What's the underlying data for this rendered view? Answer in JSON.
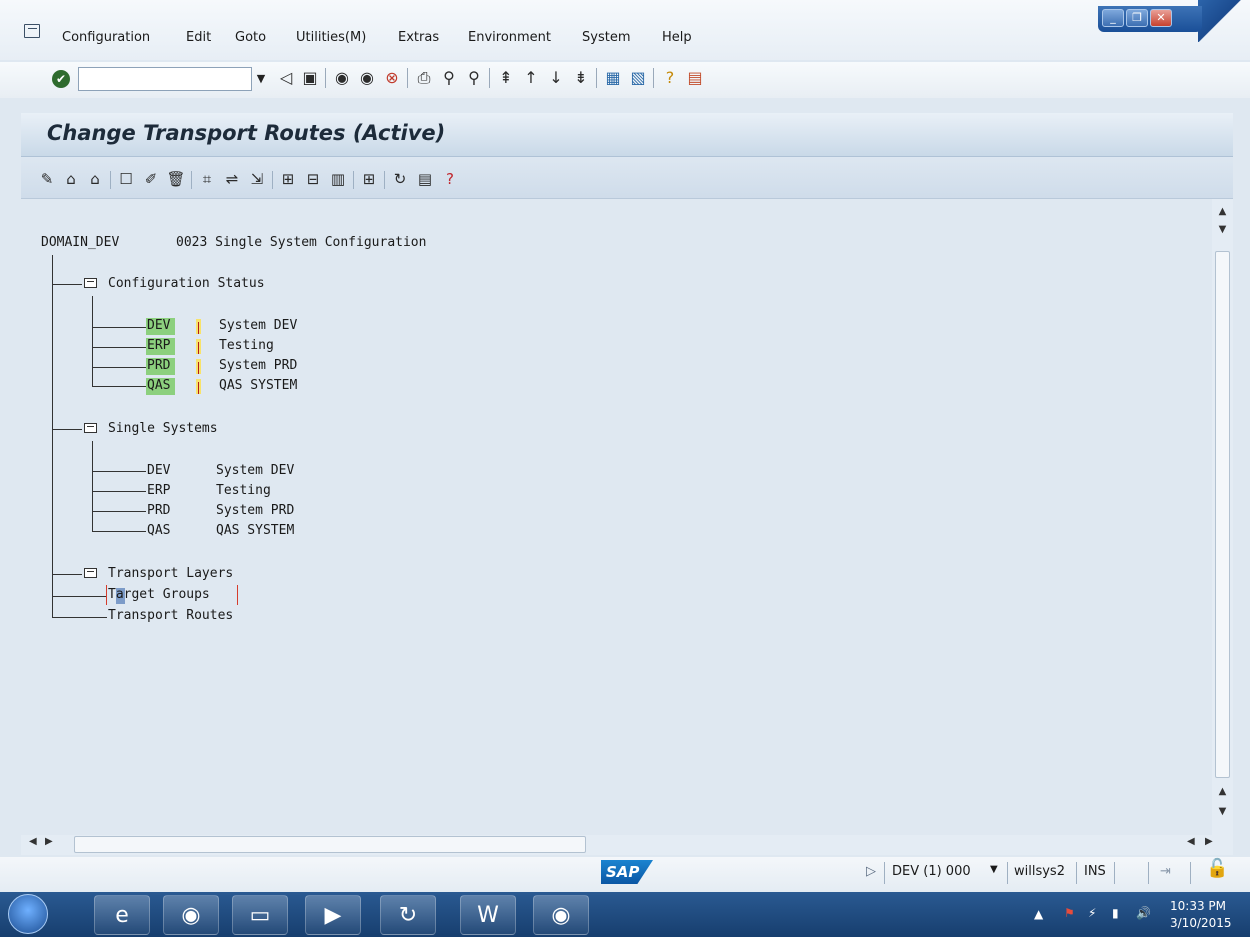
{
  "menubar": {
    "items": [
      "Configuration",
      "Edit",
      "Goto",
      "Utilities(M)",
      "Extras",
      "Environment",
      "System",
      "Help"
    ]
  },
  "window_controls": {
    "min": "_",
    "restore": "❐",
    "close": "✕"
  },
  "command_field": {
    "value": ""
  },
  "title": "Change Transport Routes (Active)",
  "tree": {
    "root": {
      "domain": "DOMAIN_DEV",
      "description": "0023 Single System Configuration"
    },
    "config_status": {
      "label": "Configuration Status",
      "systems": [
        {
          "sid": "DEV",
          "desc": "System DEV"
        },
        {
          "sid": "ERP",
          "desc": "Testing"
        },
        {
          "sid": "PRD",
          "desc": "System PRD"
        },
        {
          "sid": "QAS",
          "desc": "QAS SYSTEM"
        }
      ]
    },
    "single_systems": {
      "label": "Single Systems",
      "systems": [
        {
          "sid": "DEV",
          "desc": "System DEV"
        },
        {
          "sid": "ERP",
          "desc": "Testing"
        },
        {
          "sid": "PRD",
          "desc": "System PRD"
        },
        {
          "sid": "QAS",
          "desc": "QAS SYSTEM"
        }
      ]
    },
    "transport_layers": "Transport Layers",
    "target_groups": "Target Groups",
    "transport_routes": "Transport Routes"
  },
  "status": {
    "sap_logo": "SAP",
    "system": "DEV (1) 000",
    "server": "willsys2",
    "mode": "INS"
  },
  "tray": {
    "time": "10:33 PM",
    "date": "3/10/2015"
  },
  "colors": {
    "highlight_green": "#8cd07e",
    "title_bg": "#c9d9e8",
    "content_bg": "#dfe8f1",
    "taskbar": "#1f4a80"
  }
}
